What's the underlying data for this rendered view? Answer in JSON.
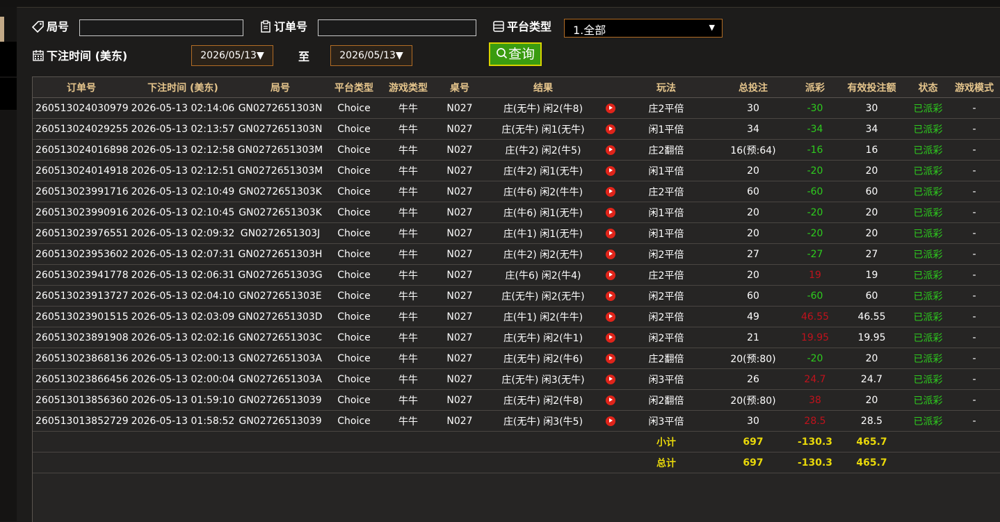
{
  "filters": {
    "round_label": "局号",
    "round_value": "",
    "order_label": "订单号",
    "order_value": "",
    "platform_label": "平台类型",
    "platform_selected": "1.全部",
    "time_label": "下注时间 (美东)",
    "date_from": "2026/05/13",
    "to_label": "至",
    "date_to": "2026/05/13",
    "query_label": "查询"
  },
  "table": {
    "headers": [
      "订单号",
      "下注时间 (美东)",
      "局号",
      "平台类型",
      "游戏类型",
      "桌号",
      "结果",
      "",
      "玩法",
      "总投注",
      "派彩",
      "有效投注额",
      "状态",
      "游戏模式"
    ],
    "rows": [
      {
        "order": "260513024030979",
        "time": "2026-05-13 02:14:06",
        "round": "GN0272651303N",
        "platform": "Choice",
        "game": "牛牛",
        "table": "N027",
        "result": "庄(无牛) 闲2(牛8)",
        "play": "庄2平倍",
        "total": "30",
        "payout": "-30",
        "payout_sign": "neg",
        "valid": "30",
        "status": "已派彩",
        "mode": "-"
      },
      {
        "order": "260513024029255",
        "time": "2026-05-13 02:13:57",
        "round": "GN0272651303N",
        "platform": "Choice",
        "game": "牛牛",
        "table": "N027",
        "result": "庄(无牛) 闲1(无牛)",
        "play": "闲1平倍",
        "total": "34",
        "payout": "-34",
        "payout_sign": "neg",
        "valid": "34",
        "status": "已派彩",
        "mode": "-"
      },
      {
        "order": "260513024016898",
        "time": "2026-05-13 02:12:58",
        "round": "GN0272651303M",
        "platform": "Choice",
        "game": "牛牛",
        "table": "N027",
        "result": "庄(牛2) 闲2(牛5)",
        "play": "庄2翻倍",
        "total": "16(预:64)",
        "payout": "-16",
        "payout_sign": "neg",
        "valid": "16",
        "status": "已派彩",
        "mode": "-"
      },
      {
        "order": "260513024014918",
        "time": "2026-05-13 02:12:51",
        "round": "GN0272651303M",
        "platform": "Choice",
        "game": "牛牛",
        "table": "N027",
        "result": "庄(牛2) 闲1(无牛)",
        "play": "闲1平倍",
        "total": "20",
        "payout": "-20",
        "payout_sign": "neg",
        "valid": "20",
        "status": "已派彩",
        "mode": "-"
      },
      {
        "order": "260513023991716",
        "time": "2026-05-13 02:10:49",
        "round": "GN0272651303K",
        "platform": "Choice",
        "game": "牛牛",
        "table": "N027",
        "result": "庄(牛6) 闲2(牛牛)",
        "play": "庄2平倍",
        "total": "60",
        "payout": "-60",
        "payout_sign": "neg",
        "valid": "60",
        "status": "已派彩",
        "mode": "-"
      },
      {
        "order": "260513023990916",
        "time": "2026-05-13 02:10:45",
        "round": "GN0272651303K",
        "platform": "Choice",
        "game": "牛牛",
        "table": "N027",
        "result": "庄(牛6) 闲1(无牛)",
        "play": "闲1平倍",
        "total": "20",
        "payout": "-20",
        "payout_sign": "neg",
        "valid": "20",
        "status": "已派彩",
        "mode": "-"
      },
      {
        "order": "260513023976551",
        "time": "2026-05-13 02:09:32",
        "round": "GN0272651303J",
        "platform": "Choice",
        "game": "牛牛",
        "table": "N027",
        "result": "庄(牛1) 闲1(无牛)",
        "play": "闲1平倍",
        "total": "20",
        "payout": "-20",
        "payout_sign": "neg",
        "valid": "20",
        "status": "已派彩",
        "mode": "-"
      },
      {
        "order": "260513023953602",
        "time": "2026-05-13 02:07:31",
        "round": "GN0272651303H",
        "platform": "Choice",
        "game": "牛牛",
        "table": "N027",
        "result": "庄(牛2) 闲2(无牛)",
        "play": "闲2平倍",
        "total": "27",
        "payout": "-27",
        "payout_sign": "neg",
        "valid": "27",
        "status": "已派彩",
        "mode": "-"
      },
      {
        "order": "260513023941778",
        "time": "2026-05-13 02:06:31",
        "round": "GN0272651303G",
        "platform": "Choice",
        "game": "牛牛",
        "table": "N027",
        "result": "庄(牛6) 闲2(牛4)",
        "play": "庄2平倍",
        "total": "20",
        "payout": "19",
        "payout_sign": "pos",
        "valid": "19",
        "status": "已派彩",
        "mode": "-"
      },
      {
        "order": "260513023913727",
        "time": "2026-05-13 02:04:10",
        "round": "GN0272651303E",
        "platform": "Choice",
        "game": "牛牛",
        "table": "N027",
        "result": "庄(无牛) 闲2(无牛)",
        "play": "闲2平倍",
        "total": "60",
        "payout": "-60",
        "payout_sign": "neg",
        "valid": "60",
        "status": "已派彩",
        "mode": "-"
      },
      {
        "order": "260513023901515",
        "time": "2026-05-13 02:03:09",
        "round": "GN0272651303D",
        "platform": "Choice",
        "game": "牛牛",
        "table": "N027",
        "result": "庄(牛1) 闲2(牛牛)",
        "play": "闲2平倍",
        "total": "49",
        "payout": "46.55",
        "payout_sign": "pos",
        "valid": "46.55",
        "status": "已派彩",
        "mode": "-"
      },
      {
        "order": "260513023891908",
        "time": "2026-05-13 02:02:16",
        "round": "GN0272651303C",
        "platform": "Choice",
        "game": "牛牛",
        "table": "N027",
        "result": "庄(无牛) 闲2(牛1)",
        "play": "闲2平倍",
        "total": "21",
        "payout": "19.95",
        "payout_sign": "pos",
        "valid": "19.95",
        "status": "已派彩",
        "mode": "-"
      },
      {
        "order": "260513023868136",
        "time": "2026-05-13 02:00:13",
        "round": "GN0272651303A",
        "platform": "Choice",
        "game": "牛牛",
        "table": "N027",
        "result": "庄(无牛) 闲2(牛6)",
        "play": "庄2翻倍",
        "total": "20(预:80)",
        "payout": "-20",
        "payout_sign": "neg",
        "valid": "20",
        "status": "已派彩",
        "mode": "-"
      },
      {
        "order": "260513023866456",
        "time": "2026-05-13 02:00:04",
        "round": "GN0272651303A",
        "platform": "Choice",
        "game": "牛牛",
        "table": "N027",
        "result": "庄(无牛) 闲3(无牛)",
        "play": "闲3平倍",
        "total": "26",
        "payout": "24.7",
        "payout_sign": "pos",
        "valid": "24.7",
        "status": "已派彩",
        "mode": "-"
      },
      {
        "order": "260513013856360",
        "time": "2026-05-13 01:59:10",
        "round": "GN02726513039",
        "platform": "Choice",
        "game": "牛牛",
        "table": "N027",
        "result": "庄(无牛) 闲2(牛8)",
        "play": "闲2翻倍",
        "total": "20(预:80)",
        "payout": "38",
        "payout_sign": "pos",
        "valid": "20",
        "status": "已派彩",
        "mode": "-"
      },
      {
        "order": "260513013852729",
        "time": "2026-05-13 01:58:52",
        "round": "GN02726513039",
        "platform": "Choice",
        "game": "牛牛",
        "table": "N027",
        "result": "庄(无牛) 闲3(牛5)",
        "play": "闲3平倍",
        "total": "30",
        "payout": "28.5",
        "payout_sign": "pos",
        "valid": "28.5",
        "status": "已派彩",
        "mode": "-"
      }
    ],
    "subtotal": {
      "label": "小计",
      "total": "697",
      "payout": "-130.3",
      "valid": "465.7"
    },
    "grandtotal": {
      "label": "总计",
      "total": "697",
      "payout": "-130.3",
      "valid": "465.7"
    }
  },
  "colors": {
    "header_text": "#e5c58c",
    "positive_payout": "#c1121c",
    "negative_payout": "#2ecc1e",
    "status": "#2ecc1e",
    "sum_text": "#e8d80a",
    "query_button": "#3a9c10"
  },
  "icons": {
    "round": "tag-icon",
    "order": "clipboard-icon",
    "platform": "list-icon",
    "time": "calendar-icon",
    "query": "search-icon",
    "row_action": "play-icon"
  }
}
